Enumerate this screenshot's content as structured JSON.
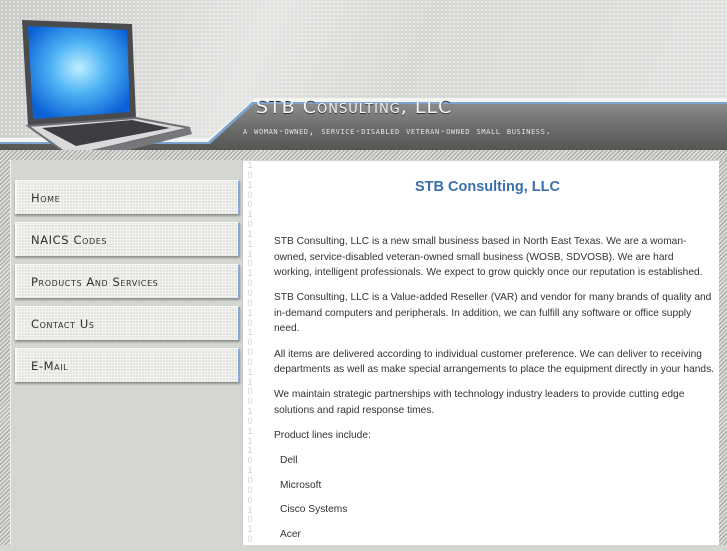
{
  "header": {
    "site_title": "STB Consulting, LLC",
    "tagline": "A woman-owned, service-disabled veteran-owned small business."
  },
  "sidebar": {
    "items": [
      {
        "label": "Home"
      },
      {
        "label": "NAICS Codes"
      },
      {
        "label": "Products and Services"
      },
      {
        "label": "Contact Us"
      },
      {
        "label": "E-mail"
      }
    ]
  },
  "binary_strip": "1\n0\n1\n0\n0\n1\n0\n1\n1\n1\n0\n1\n0\n0\n0\n1\n0\n1\n0\n0\n0\n1\n1\n0\n0\n1\n0\n1\n1\n1\n0\n1\n0\n0\n0\n1\n0\n1\n0",
  "main": {
    "title": "STB Consulting, LLC",
    "paragraphs": [
      "STB Consulting, LLC is a new small business based in North East Texas. We are a woman-owned, service-disabled veteran-owned small business (WOSB, SDVOSB). We are hard working, intelligent professionals. We expect to grow quickly once our reputation is established.",
      "STB Consulting, LLC is a Value-added Reseller (VAR) and vendor for many brands of quality and in-demand computers and peripherals. In addition, we can fulfill any software or office supply need.",
      "All items are delivered according to individual customer preference. We can deliver to receiving departments as well as make special arrangements to place the equipment directly in your hands.",
      "We maintain strategic partnerships with technology industry leaders to provide cutting edge solutions and rapid response times.",
      "Product lines include:"
    ],
    "product_lines": [
      "Dell",
      "Microsoft",
      "Cisco Systems",
      "Acer"
    ]
  },
  "colors": {
    "title_blue": "#3a6fae",
    "band_dark": "#5d5e5c",
    "accent_blue": "#86a9d6",
    "sidebar_bg": "#d4d6d1"
  }
}
